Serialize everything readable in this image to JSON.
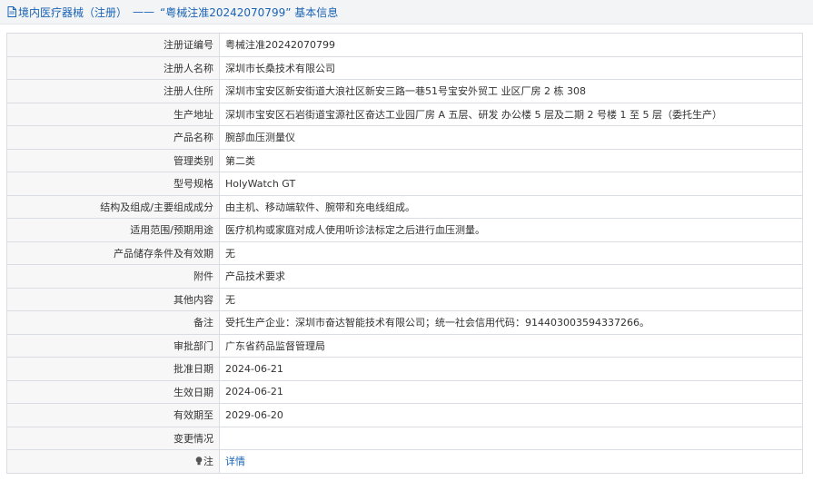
{
  "header": {
    "category": "境内医疗器械（注册）",
    "separator": "——",
    "title": "“粤械注准20242070799” 基本信息",
    "icon": "document-icon"
  },
  "rows": [
    {
      "key": "reg_no",
      "label": "注册证编号",
      "value": "粤械注准20242070799"
    },
    {
      "key": "registrant_name",
      "label": "注册人名称",
      "value": "深圳市长桑技术有限公司"
    },
    {
      "key": "registrant_address",
      "label": "注册人住所",
      "value": "深圳市宝安区新安街道大浪社区新安三路一巷51号宝安外贸工 业区厂房 2 栋 308"
    },
    {
      "key": "production_address",
      "label": "生产地址",
      "value": "深圳市宝安区石岩街道宝源社区奋达工业园厂房 A 五层、研发 办公楼 5 层及二期 2 号楼 1 至 5 层（委托生产）"
    },
    {
      "key": "product_name",
      "label": "产品名称",
      "value": "腕部血压测量仪"
    },
    {
      "key": "class",
      "label": "管理类别",
      "value": "第二类"
    },
    {
      "key": "model",
      "label": "型号规格",
      "value": "HolyWatch GT"
    },
    {
      "key": "composition",
      "label": "结构及组成/主要组成成分",
      "value": "由主机、移动端软件、腕带和充电线组成。"
    },
    {
      "key": "scope",
      "label": "适用范围/预期用途",
      "value": "医疗机构或家庭对成人使用听诊法标定之后进行血压测量。"
    },
    {
      "key": "storage",
      "label": "产品储存条件及有效期",
      "value": "无"
    },
    {
      "key": "attachment",
      "label": "附件",
      "value": "产品技术要求"
    },
    {
      "key": "other",
      "label": "其他内容",
      "value": "无"
    },
    {
      "key": "remarks",
      "label": "备注",
      "value": "受托生产企业：深圳市奋达智能技术有限公司；统一社会信用代码：914403003594337266。"
    },
    {
      "key": "authority",
      "label": "审批部门",
      "value": "广东省药品监督管理局"
    },
    {
      "key": "approval_date",
      "label": "批准日期",
      "value": "2024-06-21"
    },
    {
      "key": "effective_date",
      "label": "生效日期",
      "value": "2024-06-21"
    },
    {
      "key": "expiry_date",
      "label": "有效期至",
      "value": "2029-06-20"
    },
    {
      "key": "changes",
      "label": "变更情况",
      "value": ""
    }
  ],
  "note_row": {
    "label": "注",
    "icon": "lightbulb-icon",
    "link_text": "详情"
  },
  "colors": {
    "link": "#1a63b4",
    "label_bg": "#f7f7f7",
    "border": "#d9dde3",
    "header_bg": "#f3f4f6"
  }
}
